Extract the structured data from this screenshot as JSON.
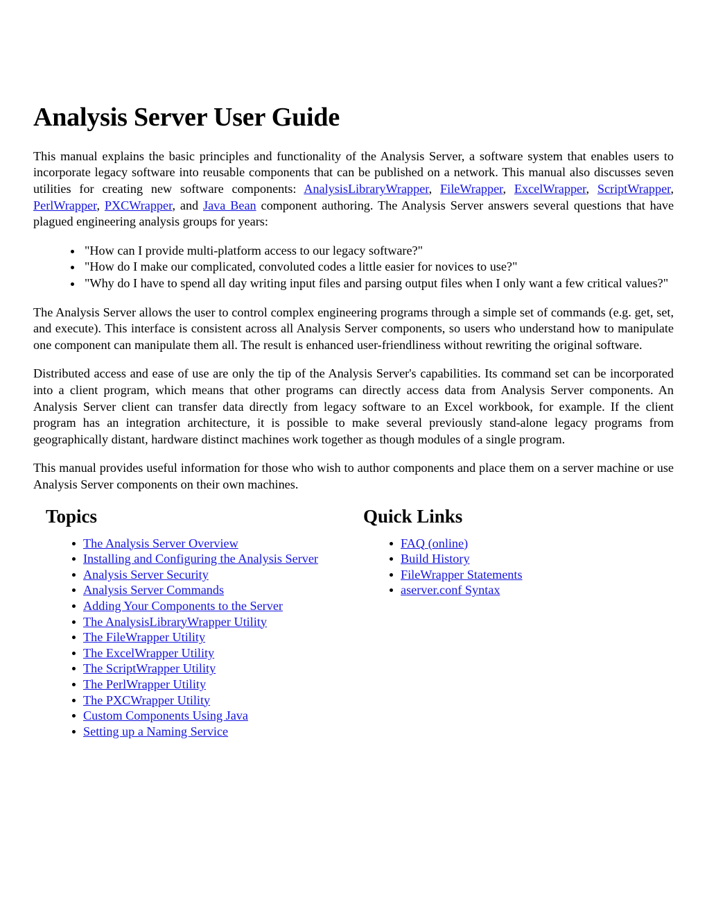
{
  "document": {
    "title": "Analysis Server User Guide"
  },
  "intro": {
    "p1_seg1": "This manual explains the basic principles and functionality of the Analysis Server, a software system that enables users to incorporate legacy software into reusable components that can be published on a network. This manual also discusses seven utilities for creating new software components: ",
    "p1_link1": "AnalysisLibraryWrapper",
    "p1_sep1": ", ",
    "p1_link2": "FileWrapper",
    "p1_sep2": ", ",
    "p1_link3": "ExcelWrapper",
    "p1_sep3": ", ",
    "p1_link4": "ScriptWrapper",
    "p1_sep4": ", ",
    "p1_link5": "PerlWrapper",
    "p1_sep5": ", ",
    "p1_link6": "PXCWrapper",
    "p1_sep6": ", and ",
    "p1_link7": "Java Bean",
    "p1_seg2": " component authoring. The Analysis Server answers several questions that have plagued engineering analysis groups for years:"
  },
  "questions": [
    "\"How can I provide multi-platform access to our legacy software?\"",
    "\"How do I make our complicated, convoluted codes a little easier for novices to use?\"",
    "\"Why do I have to spend all day writing input files and parsing output files when I only want a few critical values?\""
  ],
  "body": {
    "p2": "The Analysis Server allows the user to control complex engineering programs through a simple set of commands (e.g. get, set, and execute). This interface is consistent across all Analysis Server components, so users who understand how to manipulate one component can manipulate them all. The result is enhanced user-friendliness without rewriting the original software.",
    "p3": "Distributed access and ease of use are only the tip of the Analysis Server's capabilities. Its command set can be incorporated into a client program, which means that other programs can directly access data from Analysis Server components. An Analysis Server client can transfer data directly from legacy software to an Excel workbook, for example. If the client program has an integration architecture, it is possible to make several previously stand-alone legacy programs from geographically distant, hardware distinct machines work together as though modules of a single program.",
    "p4": "This manual provides useful information for those who wish to author components and place them on a server machine or use Analysis Server components on their own machines."
  },
  "topics": {
    "heading": "Topics",
    "items": [
      "The Analysis Server Overview",
      "Installing and Configuring the Analysis Server",
      "Analysis Server Security",
      "Analysis Server Commands",
      "Adding Your Components to the Server",
      "The AnalysisLibraryWrapper Utility",
      "The FileWrapper Utility",
      "The ExcelWrapper Utility",
      "The ScriptWrapper Utility",
      "The PerlWrapper Utility",
      "The PXCWrapper Utility",
      "Custom Components Using Java",
      "Setting up a Naming Service"
    ]
  },
  "quick_links": {
    "heading": "Quick Links",
    "items": [
      "FAQ (online)",
      "Build History",
      "FileWrapper Statements",
      "aserver.conf Syntax"
    ]
  },
  "colors": {
    "link": "#1414e0",
    "text": "#000000",
    "background": "#ffffff"
  }
}
